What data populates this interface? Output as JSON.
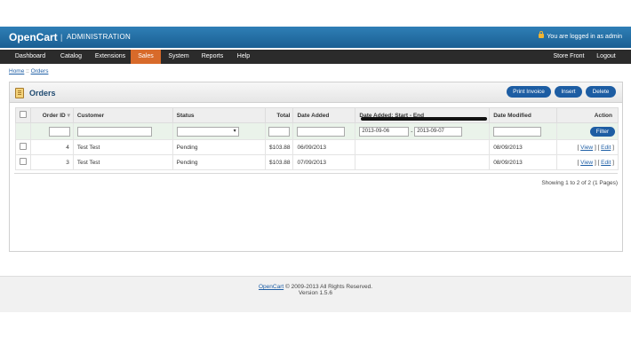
{
  "header": {
    "logo": "OpenCart",
    "separator": "|",
    "subtitle": "ADMINISTRATION",
    "logged_in": "You are logged in as admin"
  },
  "menu": {
    "items": [
      {
        "label": "Dashboard"
      },
      {
        "label": "Catalog"
      },
      {
        "label": "Extensions"
      },
      {
        "label": "Sales",
        "active": true
      },
      {
        "label": "System"
      },
      {
        "label": "Reports"
      },
      {
        "label": "Help"
      }
    ],
    "right": [
      {
        "label": "Store Front"
      },
      {
        "label": "Logout"
      }
    ]
  },
  "breadcrumb": {
    "home": "Home",
    "separator": " :: ",
    "current": "Orders"
  },
  "page": {
    "title": "Orders",
    "buttons": {
      "print": "Print Invoice",
      "insert": "Insert",
      "delete": "Delete"
    }
  },
  "table": {
    "headers": {
      "order_id": "Order ID",
      "customer": "Customer",
      "status": "Status",
      "total": "Total",
      "date_added": "Date Added",
      "date_range": "Date Added: Start - End",
      "date_modified": "Date Modified",
      "action": "Action"
    },
    "filter": {
      "start": "2013-09-06",
      "end": "2013-09-07",
      "dash": "-",
      "button": "Filter"
    },
    "rows": [
      {
        "order_id": "4",
        "customer": "Test Test",
        "status": "Pending",
        "total": "$103.88",
        "date_added": "06/09/2013",
        "date_modified": "08/09/2013",
        "view": "View",
        "edit": "Edit"
      },
      {
        "order_id": "3",
        "customer": "Test Test",
        "status": "Pending",
        "total": "$103.88",
        "date_added": "07/09/2013",
        "date_modified": "08/09/2013",
        "view": "View",
        "edit": "Edit"
      }
    ]
  },
  "pagination": {
    "text": "Showing 1 to 2 of 2 (1 Pages)"
  },
  "footer": {
    "link": "OpenCart",
    "copyright": "© 2009-2013 All Rights Reserved.",
    "version": "Version 1.5.6"
  },
  "icons": {
    "lock": "lock-icon",
    "orders": "document-icon",
    "sort": "sort-arrow-icon",
    "select": "dropdown-arrow-icon"
  },
  "colors": {
    "header": "#1f6aa5",
    "menu": "#2b2b2b",
    "active_menu": "#d86a2a",
    "button": "#1d5da3"
  }
}
